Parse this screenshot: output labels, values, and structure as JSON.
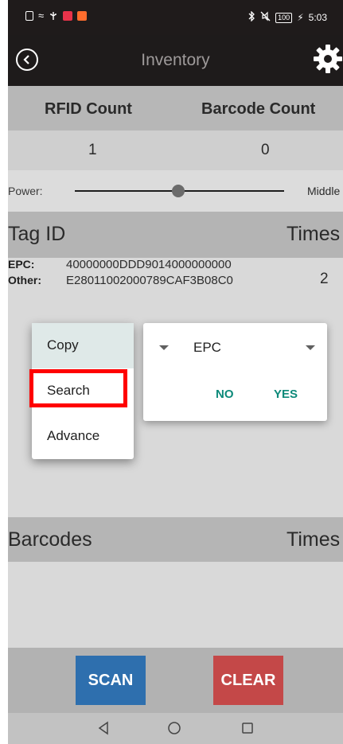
{
  "status_bar": {
    "battery": "100",
    "time": "5:03",
    "icons": [
      "sim-icon",
      "wifi-icon",
      "usb-icon",
      "notification-icon",
      "media-icon",
      "bluetooth-icon",
      "mute-icon",
      "battery-icon"
    ]
  },
  "app_bar": {
    "title": "Inventory",
    "back_icon": "back-circle-icon",
    "settings_icon": "gear-icon"
  },
  "counts": {
    "rfid_label": "RFID Count",
    "barcode_label": "Barcode Count",
    "rfid_value": "1",
    "barcode_value": "0"
  },
  "power": {
    "label": "Power:",
    "value_label": "Middle",
    "slider_level": 0.5
  },
  "tags": {
    "header_id": "Tag ID",
    "header_times": "Times",
    "rows": [
      {
        "epc_label": "EPC:",
        "epc": "40000000DDD9014000000000",
        "other_label": "Other:",
        "other": "E28011002000789CAF3B08C0",
        "times": "2"
      }
    ]
  },
  "dialog": {
    "dropdown_value": "EPC",
    "no_label": "NO",
    "yes_label": "YES"
  },
  "context_menu": {
    "items": [
      {
        "label": "Copy",
        "focused": true
      },
      {
        "label": "Search",
        "focused": false
      },
      {
        "label": "Advance",
        "focused": false
      }
    ],
    "highlighted_item": "Search"
  },
  "barcodes": {
    "header": "Barcodes",
    "header_times": "Times"
  },
  "actions": {
    "scan_label": "SCAN",
    "clear_label": "CLEAR"
  },
  "colors": {
    "accent_dialog": "#0d8a7a",
    "scan_button": "#2e6fae",
    "clear_button": "#c44848",
    "highlight": "#ff0000"
  }
}
